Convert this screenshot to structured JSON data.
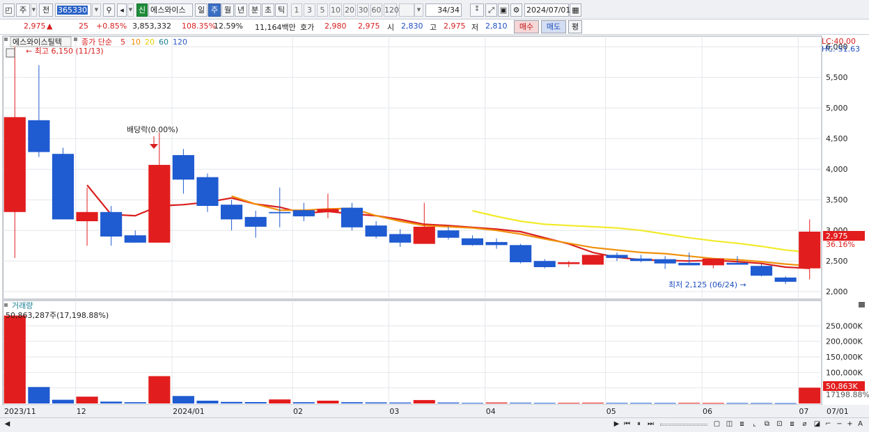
{
  "toolbar": {
    "market_label": "주",
    "prev_label": "전",
    "stock_code": "365330",
    "search_icon": "magnifier-icon",
    "sound_icon": "speaker-icon",
    "new_badge": "신",
    "stock_name": "에스와이스",
    "periods": [
      "일",
      "주",
      "월",
      "년",
      "분",
      "초",
      "틱"
    ],
    "selected_period": "주",
    "minute_units": [
      "1",
      "3",
      "5",
      "10",
      "20",
      "30",
      "60",
      "120"
    ],
    "count_value": "34",
    "count_total": "/34",
    "date_value": "2024/07/01",
    "calendar_icon": "calendar-icon"
  },
  "quote": {
    "price": "2,975",
    "change_arrow": "▲",
    "change": "25",
    "change_pct": "+0.85%",
    "volume": "3,853,332",
    "volume_ratio": "108.35%",
    "turnover": "12.59%",
    "amount": "11,164백만",
    "bid_label": "호가",
    "bid1": "2,980",
    "bid2": "2,975",
    "open_label": "시",
    "open": "2,830",
    "high_label": "고",
    "high": "2,975",
    "low_label": "저",
    "low": "2,810",
    "buy_button": "매수",
    "sell_button": "매도",
    "eval_button": "평"
  },
  "chart_data": [
    {
      "type": "candlestick",
      "title": "에스와이스틸텍",
      "legend": {
        "label": "종가 단순",
        "periods": [
          "5",
          "10",
          "20",
          "60",
          "120"
        ],
        "colors": [
          "#d81e1e",
          "#f08a00",
          "#e6d000",
          "#1a7f94",
          "#2a58c8"
        ]
      },
      "y_ticks": [
        "6,000",
        "5,500",
        "5,000",
        "4,500",
        "4,000",
        "3,500",
        "3,000",
        "2,500",
        "2,000"
      ],
      "ylim": [
        1900,
        6150
      ],
      "lc_label": "LC:40.00",
      "hc_label": "HC:-51.63",
      "current_price_label": "2,975",
      "current_pct_label": "36.16%",
      "max_annotation": "최고 6,150 (11/13)",
      "min_annotation": "최저 2,125 (06/24)",
      "dividend_annotation": "배당락(0.00%)",
      "candles": [
        {
          "o": 3300,
          "h": 6150,
          "l": 2550,
          "c": 4850
        },
        {
          "o": 4800,
          "h": 5700,
          "l": 4200,
          "c": 4280
        },
        {
          "o": 4250,
          "h": 4350,
          "l": 3200,
          "c": 3180
        },
        {
          "o": 3150,
          "h": 3700,
          "l": 2750,
          "c": 3300
        },
        {
          "o": 3300,
          "h": 3400,
          "l": 2750,
          "c": 2900
        },
        {
          "o": 2920,
          "h": 3000,
          "l": 2800,
          "c": 2800
        },
        {
          "o": 2800,
          "h": 4600,
          "l": 2800,
          "c": 4070
        },
        {
          "o": 4230,
          "h": 4330,
          "l": 3600,
          "c": 3830
        },
        {
          "o": 3870,
          "h": 3930,
          "l": 3300,
          "c": 3400
        },
        {
          "o": 3420,
          "h": 3500,
          "l": 3000,
          "c": 3180
        },
        {
          "o": 3220,
          "h": 3320,
          "l": 2880,
          "c": 3060
        },
        {
          "o": 3300,
          "h": 3700,
          "l": 3050,
          "c": 3280
        },
        {
          "o": 3330,
          "h": 3450,
          "l": 3150,
          "c": 3230
        },
        {
          "o": 3300,
          "h": 3600,
          "l": 3200,
          "c": 3350
        },
        {
          "o": 3370,
          "h": 3450,
          "l": 3000,
          "c": 3050
        },
        {
          "o": 3080,
          "h": 3150,
          "l": 2870,
          "c": 2900
        },
        {
          "o": 2940,
          "h": 3020,
          "l": 2730,
          "c": 2800
        },
        {
          "o": 2780,
          "h": 3450,
          "l": 2780,
          "c": 3060
        },
        {
          "o": 3000,
          "h": 3060,
          "l": 2850,
          "c": 2880
        },
        {
          "o": 2870,
          "h": 2920,
          "l": 2750,
          "c": 2760
        },
        {
          "o": 2810,
          "h": 2870,
          "l": 2700,
          "c": 2760
        },
        {
          "o": 2760,
          "h": 2780,
          "l": 2460,
          "c": 2480
        },
        {
          "o": 2500,
          "h": 2530,
          "l": 2380,
          "c": 2400
        },
        {
          "o": 2450,
          "h": 2500,
          "l": 2400,
          "c": 2480
        },
        {
          "o": 2440,
          "h": 2600,
          "l": 2440,
          "c": 2600
        },
        {
          "o": 2600,
          "h": 2640,
          "l": 2500,
          "c": 2550
        },
        {
          "o": 2540,
          "h": 2600,
          "l": 2480,
          "c": 2500
        },
        {
          "o": 2530,
          "h": 2580,
          "l": 2370,
          "c": 2460
        },
        {
          "o": 2470,
          "h": 2640,
          "l": 2430,
          "c": 2430
        },
        {
          "o": 2430,
          "h": 2520,
          "l": 2380,
          "c": 2540
        },
        {
          "o": 2470,
          "h": 2580,
          "l": 2440,
          "c": 2440
        },
        {
          "o": 2420,
          "h": 2450,
          "l": 2250,
          "c": 2260
        },
        {
          "o": 2230,
          "h": 2250,
          "l": 2125,
          "c": 2160
        },
        {
          "o": 2380,
          "h": 3180,
          "l": 2200,
          "c": 2980
        }
      ],
      "ma5": [
        null,
        null,
        null,
        3740,
        3260,
        3240,
        3400,
        3420,
        3460,
        3530,
        3430,
        3380,
        3280,
        3310,
        3270,
        3240,
        3180,
        3100,
        3080,
        3050,
        3020,
        2980,
        2880,
        2780,
        2640,
        2560,
        2520,
        2510,
        2500,
        2510,
        2490,
        2460,
        2400,
        2380
      ],
      "ma10": [
        null,
        null,
        null,
        null,
        null,
        null,
        null,
        null,
        null,
        3560,
        3430,
        3330,
        3330,
        3350,
        3360,
        3240,
        3150,
        3080,
        3060,
        3040,
        3000,
        2940,
        2860,
        2790,
        2720,
        2680,
        2640,
        2620,
        2580,
        2540,
        2520,
        2490,
        2450,
        2420
      ],
      "ma20": [
        null,
        null,
        null,
        null,
        null,
        null,
        null,
        null,
        null,
        null,
        null,
        null,
        null,
        null,
        null,
        null,
        null,
        null,
        null,
        3320,
        3230,
        3150,
        3100,
        3080,
        3060,
        3040,
        3000,
        2940,
        2880,
        2830,
        2790,
        2740,
        2680,
        2640
      ]
    },
    {
      "type": "bar",
      "title": "거래량",
      "label": "50,863,287주(17,198.88%)",
      "y_ticks": [
        "250,000K",
        "200,000K",
        "150,000K",
        "100,000K",
        "50,000K"
      ],
      "ylim": [
        0,
        300000
      ],
      "current_label": "50,863K",
      "current_pct": "17198.88%",
      "values": [
        283000,
        53000,
        12000,
        22000,
        6000,
        4000,
        88000,
        24000,
        9000,
        5000,
        4500,
        13000,
        4000,
        9000,
        4000,
        3500,
        3000,
        11000,
        3000,
        2000,
        3000,
        2500,
        2000,
        2200,
        2500,
        2000,
        2000,
        1800,
        2200,
        1800,
        1600,
        1500,
        1200,
        50863
      ],
      "up": [
        true,
        false,
        false,
        true,
        false,
        false,
        true,
        false,
        false,
        false,
        false,
        true,
        false,
        true,
        false,
        false,
        false,
        true,
        false,
        false,
        true,
        false,
        false,
        true,
        true,
        false,
        false,
        false,
        true,
        true,
        false,
        false,
        false,
        true
      ]
    }
  ],
  "x_axis": {
    "labels": [
      "2023/11",
      "12",
      "2024/01",
      "02",
      "03",
      "04",
      "05",
      "06",
      "07",
      "07/01"
    ]
  },
  "scrollbar": {
    "left_arrow": "◀",
    "right_arrow": "▶",
    "zoom_out": "−",
    "zoom_in": "+",
    "auto": "A"
  }
}
